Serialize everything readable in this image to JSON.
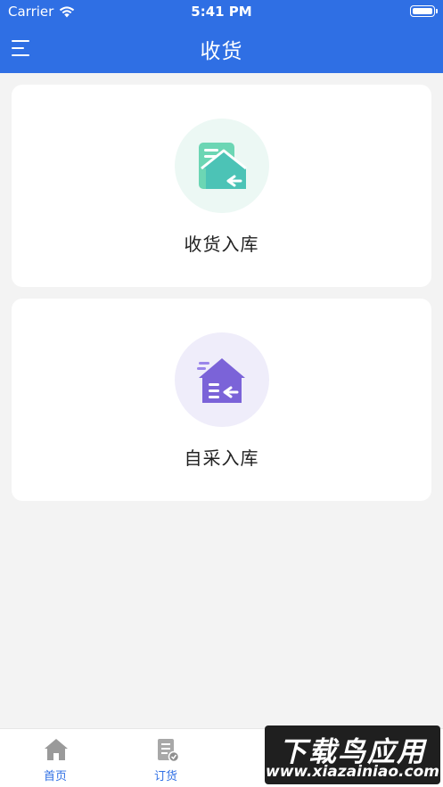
{
  "status_bar": {
    "carrier": "Carrier",
    "time": "5:41 PM"
  },
  "nav": {
    "title": "收货",
    "menu_icon": "menu-icon"
  },
  "cards": [
    {
      "label": "收货入库",
      "icon": "receive-warehouse-icon",
      "icon_color": "#4cc9a9",
      "circle_color": "#ecf8f4"
    },
    {
      "label": "自采入库",
      "icon": "self-purchase-warehouse-icon",
      "icon_color": "#7b63d8",
      "circle_color": "#efedfa"
    }
  ],
  "tabs": [
    {
      "label": "首页",
      "icon": "home-icon"
    },
    {
      "label": "订货",
      "icon": "order-icon"
    },
    {
      "label": "",
      "icon": "cart-icon"
    }
  ],
  "watermark": {
    "title": "下载鸟应用",
    "url": "www.xiazainiao.com"
  },
  "colors": {
    "primary": "#2f6fe4",
    "background": "#f3f3f3"
  }
}
